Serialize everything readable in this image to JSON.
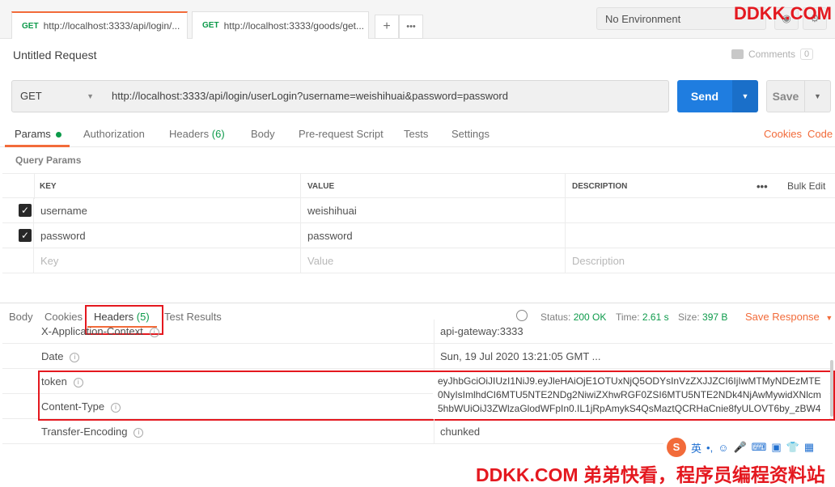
{
  "tabs": [
    {
      "method": "GET",
      "label": "http://localhost:3333/api/login/..."
    },
    {
      "method": "GET",
      "label": "http://localhost:3333/goods/get..."
    }
  ],
  "tab_actions": {
    "add": "+",
    "more": "•••"
  },
  "environment": {
    "selected": "No Environment"
  },
  "watermark_top": "DDKK.COM",
  "request": {
    "title": "Untitled Request",
    "comments_label": "Comments",
    "comments_count": "0",
    "method": "GET",
    "url": "http://localhost:3333/api/login/userLogin?username=weishihuai&password=password",
    "send_label": "Send",
    "save_label": "Save"
  },
  "request_tabs": {
    "params": "Params",
    "authorization": "Authorization",
    "headers": "Headers",
    "headers_count": "(6)",
    "body": "Body",
    "prerequest": "Pre-request Script",
    "tests": "Tests",
    "settings": "Settings",
    "cookies": "Cookies",
    "code": "Code"
  },
  "query_params": {
    "section_label": "Query Params",
    "columns": {
      "key": "KEY",
      "value": "VALUE",
      "description": "DESCRIPTION"
    },
    "bulk_edit": "Bulk Edit",
    "more": "•••",
    "rows": [
      {
        "key": "username",
        "value": "weishihuai",
        "checked": true
      },
      {
        "key": "password",
        "value": "password",
        "checked": true
      }
    ],
    "placeholders": {
      "key": "Key",
      "value": "Value",
      "description": "Description"
    }
  },
  "response": {
    "tabs": {
      "body": "Body",
      "cookies": "Cookies",
      "headers": "Headers",
      "headers_count": "(5)",
      "test_results": "Test Results"
    },
    "status_label": "Status:",
    "status_value": "200 OK",
    "time_label": "Time:",
    "time_value": "2.61 s",
    "size_label": "Size:",
    "size_value": "397 B",
    "save_response": "Save Response",
    "headers": [
      {
        "key": "X-Application-Context",
        "value": "api-gateway:3333"
      },
      {
        "key": "Date",
        "value": "Sun, 19 Jul 2020 13:21:05 GMT ..."
      },
      {
        "key": "token",
        "value": "eyJhbGciOiJIUzI1NiJ9.eyJleHAiOjE1OTUxNjQ5ODYsInVzZXJJZCI6IjIwMTMyNDEzMTE0NyIsImlhdCI6MTU5NTE2NDg2NiwiZXhwRGF0ZSI6MTU5NTE2NDk4NjAwMywidXNlcm5hbWUiOiJ3ZWlzaGlodWFpIn0.IL1jRpAmykS4QsMaztQCRHaCnie8fyULOVT6by_zBW4"
      },
      {
        "key": "Content-Type",
        "value": ""
      },
      {
        "key": "Transfer-Encoding",
        "value": "chunked"
      }
    ]
  },
  "ime": {
    "lang": "英",
    "punct": "•,"
  },
  "watermark_bottom": "DDKK.COM 弟弟快看，程序员编程资料站"
}
